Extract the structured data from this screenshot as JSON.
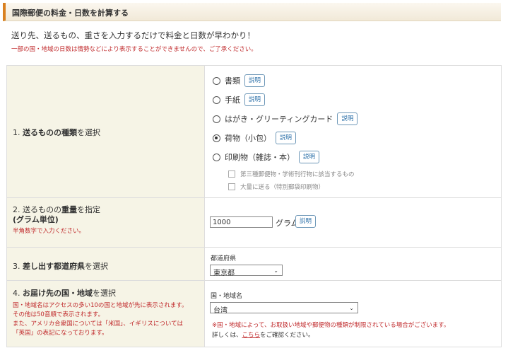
{
  "heading": "国際郵便の料金・日数を計算する",
  "intro": "送り先、送るもの、重さを入力するだけで料金と日数が早わかり！",
  "note": "一部の国・地域の日数は情勢などにより表示することができませんので、ご了承ください。",
  "help_label": "説明",
  "step1": {
    "num": "1.",
    "bold": "送るものの種類",
    "rest": "を選択",
    "options": [
      {
        "label": "書類",
        "selected": false
      },
      {
        "label": "手紙",
        "selected": false
      },
      {
        "label": "はがき・グリーティングカード",
        "selected": false
      },
      {
        "label": "荷物（小包）",
        "selected": true
      },
      {
        "label": "印刷物（雑誌・本）",
        "selected": false
      }
    ],
    "checkboxes": [
      "第三種郵便物・学術刊行物に該当するもの",
      "大量に送る（特別郵袋印刷物）"
    ]
  },
  "step2": {
    "num": "2.",
    "pre": "送るものの",
    "bold": "重量",
    "rest": "を指定",
    "sub": "(グラム単位)",
    "note": "半角数字で入力ください。",
    "value": "1000",
    "unit": "グラム"
  },
  "step3": {
    "num": "3.",
    "bold": "差し出す都道府県",
    "rest": "を選択",
    "field_label": "都道府県",
    "selected": "東京都"
  },
  "step4": {
    "num": "4.",
    "bold": "お届け先の国・地域",
    "rest": "を選択",
    "notes": [
      "国・地域名はアクセスの多い10の国と地域が先に表示されます。",
      "その他は50音順で表示されます。",
      "また、アメリカ合衆国については「米国」、イギリスについては",
      "「英国」の表記になっております。"
    ],
    "field_label": "国・地域名",
    "selected": "台湾",
    "warning": "※国・地域によって、お取扱い地域や郵便物の種類が制限されている場合がございます。",
    "detail_pre": "詳しくは、",
    "detail_link": "こちら",
    "detail_post": "をご確認ください。"
  },
  "colors": {
    "accent": "#d9801f",
    "label_bg": "#f6f4e6",
    "note_red": "#c0292b",
    "button_blue": "#2a6fa8"
  }
}
